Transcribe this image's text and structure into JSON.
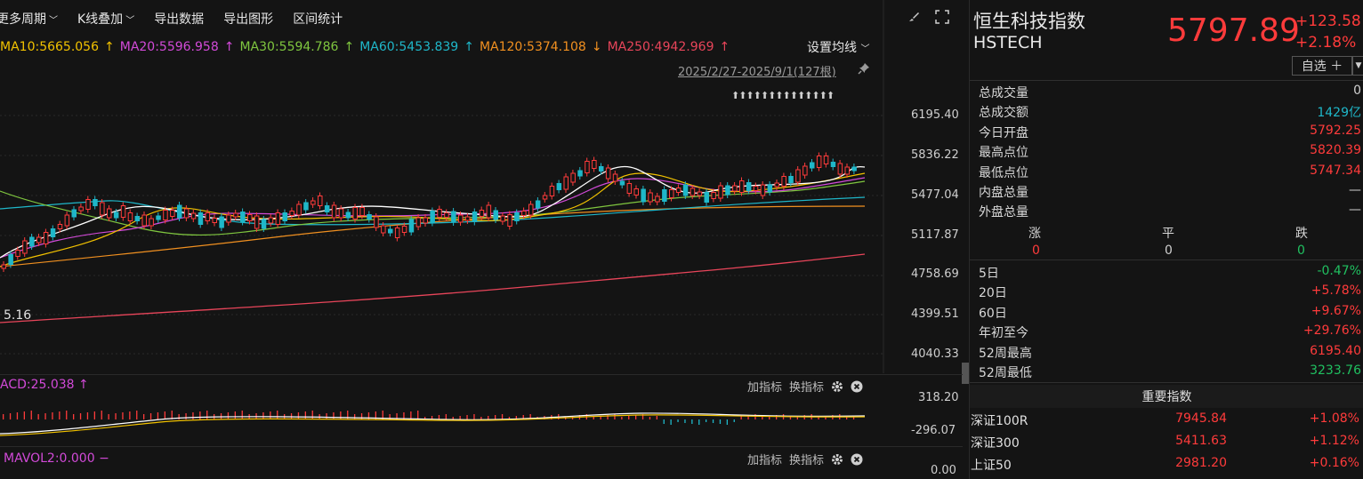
{
  "toolbar": {
    "period": "更多周期",
    "overlay": "K线叠加",
    "export_data": "导出数据",
    "export_chart": "导出图形",
    "range_stats": "区间统计"
  },
  "ma": [
    {
      "label": "MA10:5665.056",
      "arrow": "↑",
      "color": "#f2c200"
    },
    {
      "label": "MA20:5596.958",
      "arrow": "↑",
      "color": "#d24ad8"
    },
    {
      "label": "MA30:5594.786",
      "arrow": "↑",
      "color": "#7fc63f"
    },
    {
      "label": "MA60:5453.839",
      "arrow": "↑",
      "color": "#1fb7c9"
    },
    {
      "label": "MA120:5374.108",
      "arrow": "↓",
      "color": "#f19020"
    },
    {
      "label": "MA250:4942.969",
      "arrow": "↑",
      "color": "#e8455a"
    }
  ],
  "set_ma": "设置均线",
  "date_range": "2025/2/27-2025/9/1(127根)",
  "event_marks": "⬆⬆⬆⬆⬆⬆⬆⬆⬆⬆⬆⬆⬆⬆",
  "price_axis": [
    "6195.40",
    "5836.22",
    "5477.04",
    "5117.87",
    "4758.69",
    "4399.51",
    "4040.33"
  ],
  "low_marker": "5.16",
  "macd": {
    "label": "ACD:25.038",
    "arrow": "↑",
    "axis_top": "318.20",
    "axis_bottom": "-296.07"
  },
  "vol": {
    "label": "MAVOL2:0.000",
    "arrow": "−",
    "axis_bottom": "0.00"
  },
  "indicator_buttons": {
    "add": "加指标",
    "switch": "换指标"
  },
  "quote": {
    "name_cn": "恒生科技指数",
    "name_en": "HSTECH",
    "price": "5797.89",
    "change": "+123.58",
    "change_pct": "+2.18%",
    "watch": "自选 ＋"
  },
  "stats": [
    {
      "k": "总成交量",
      "v": "0",
      "color": "gray"
    },
    {
      "k": "总成交额",
      "v": "1429亿",
      "color": "cyan"
    },
    {
      "k": "今日开盘",
      "v": "5792.25",
      "color": "red"
    },
    {
      "k": "最高点位",
      "v": "5820.39",
      "color": "red"
    },
    {
      "k": "最低点位",
      "v": "5747.34",
      "color": "red"
    },
    {
      "k": "内盘总量",
      "v": "—",
      "color": "gray"
    },
    {
      "k": "外盘总量",
      "v": "—",
      "color": "gray"
    }
  ],
  "breadth": {
    "up_label": "涨",
    "flat_label": "平",
    "down_label": "跌",
    "up": "0",
    "flat": "0",
    "down": "0"
  },
  "perf": [
    {
      "k": "5日",
      "v": "-0.47%",
      "color": "green"
    },
    {
      "k": "20日",
      "v": "+5.78%",
      "color": "red"
    },
    {
      "k": "60日",
      "v": "+9.67%",
      "color": "red"
    },
    {
      "k": "年初至今",
      "v": "+29.76%",
      "color": "red"
    },
    {
      "k": "52周最高",
      "v": "6195.40",
      "color": "red"
    },
    {
      "k": "52周最低",
      "v": "3233.76",
      "color": "green"
    }
  ],
  "important_title": "重要指数",
  "indices": [
    {
      "n": "深证100R",
      "p": "7945.84",
      "c": "+1.08%"
    },
    {
      "n": "深证300",
      "p": "5411.63",
      "c": "+1.12%"
    },
    {
      "n": "上证50",
      "p": "2981.20",
      "c": "+0.16%"
    }
  ]
}
